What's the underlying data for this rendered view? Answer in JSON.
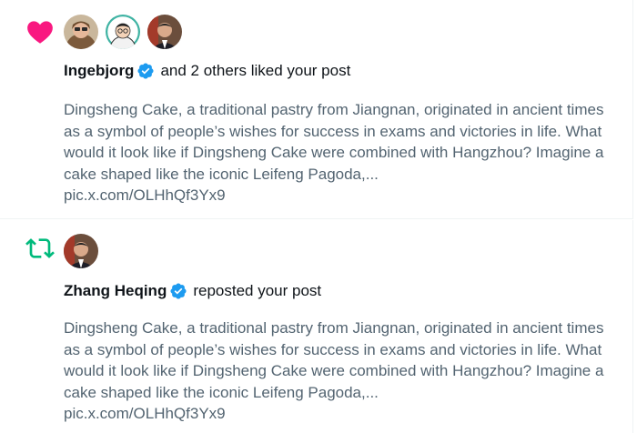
{
  "notifications": [
    {
      "type": "like",
      "icon": "heart-icon",
      "icon_color": "#f91880",
      "user": "Ingebjorg",
      "verified": true,
      "action": "and 2 others liked your post",
      "avatars": [
        "avatar-woman-sunglasses",
        "avatar-man-glasses-green",
        "avatar-man-suit"
      ],
      "post_text": "Dingsheng Cake, a traditional pastry from Jiangnan, originated in ancient times as a symbol of people’s wishes for success in exams and victories in life. What would it look like if Dingsheng Cake were combined with Hangzhou? Imagine a cake shaped like the iconic Leifeng Pagoda,...",
      "post_link": "pic.x.com/OLHhQf3Yx9"
    },
    {
      "type": "repost",
      "icon": "repost-icon",
      "icon_color": "#00ba7c",
      "user": "Zhang Heqing",
      "verified": true,
      "action": "reposted your post",
      "avatars": [
        "avatar-man-suit"
      ],
      "post_text": "Dingsheng Cake, a traditional pastry from Jiangnan, originated in ancient times as a symbol of people’s wishes for success in exams and victories in life. What would it look like if Dingsheng Cake were combined with Hangzhou? Imagine a cake shaped like the iconic Leifeng Pagoda,...",
      "post_link": "pic.x.com/OLHhQf3Yx9"
    }
  ],
  "colors": {
    "verified_badge": "#1d9bf0",
    "secondary_text": "#536471",
    "divider": "#eff3f4"
  }
}
